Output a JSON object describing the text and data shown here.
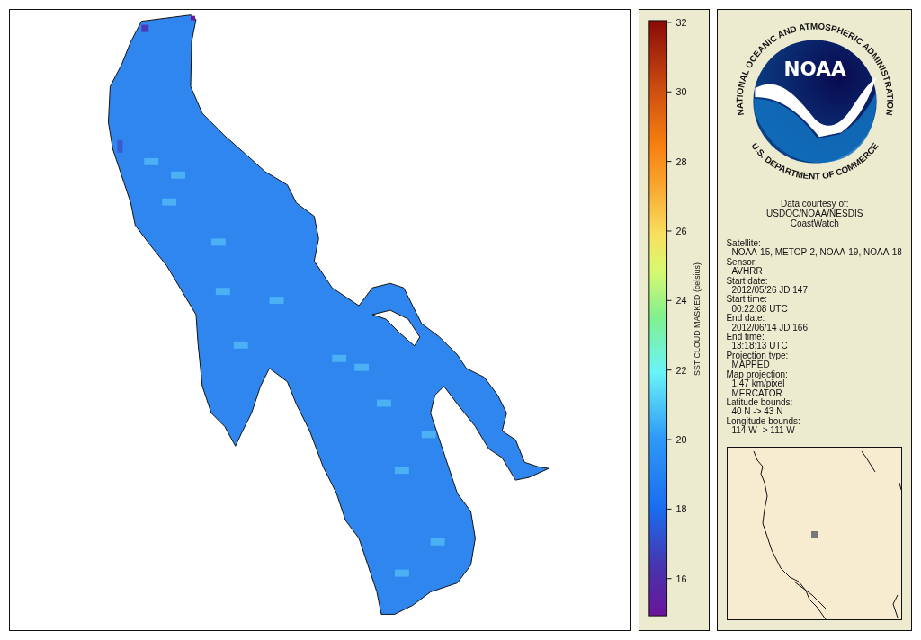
{
  "colorbar": {
    "title": "SST CLOUD MASKED (celsius)",
    "ticks": [
      "32",
      "30",
      "28",
      "26",
      "24",
      "22",
      "20",
      "18",
      "16"
    ]
  },
  "logo": {
    "wordmark": "NOAA",
    "top_text": "NATIONAL OCEANIC AND ATMOSPHERIC ADMINISTRATION",
    "bottom_text": "U.S. DEPARTMENT OF COMMERCE"
  },
  "credit": [
    "Data courtesy of:",
    "USDOC/NOAA/NESDIS",
    "CoastWatch"
  ],
  "metadata": [
    {
      "label": "Satellite:",
      "values": [
        "NOAA-15, METOP-2, NOAA-19, NOAA-18"
      ]
    },
    {
      "label": "Sensor:",
      "values": [
        "AVHRR"
      ]
    },
    {
      "label": "Start date:",
      "values": [
        "2012/05/26 JD 147"
      ]
    },
    {
      "label": "Start time:",
      "values": [
        "00:22:08 UTC"
      ]
    },
    {
      "label": "End date:",
      "values": [
        "2012/06/14 JD 166"
      ]
    },
    {
      "label": "End time:",
      "values": [
        "13:18:13 UTC"
      ]
    },
    {
      "label": "Projection type:",
      "values": [
        "MAPPED"
      ]
    },
    {
      "label": "Map projection:",
      "values": [
        "1.47 km/pixel",
        "MERCATOR"
      ]
    },
    {
      "label": "Latitude bounds:",
      "values": [
        "40 N -> 43 N"
      ]
    },
    {
      "label": "Longitude bounds:",
      "values": [
        "114 W -> 111 W"
      ]
    }
  ]
}
